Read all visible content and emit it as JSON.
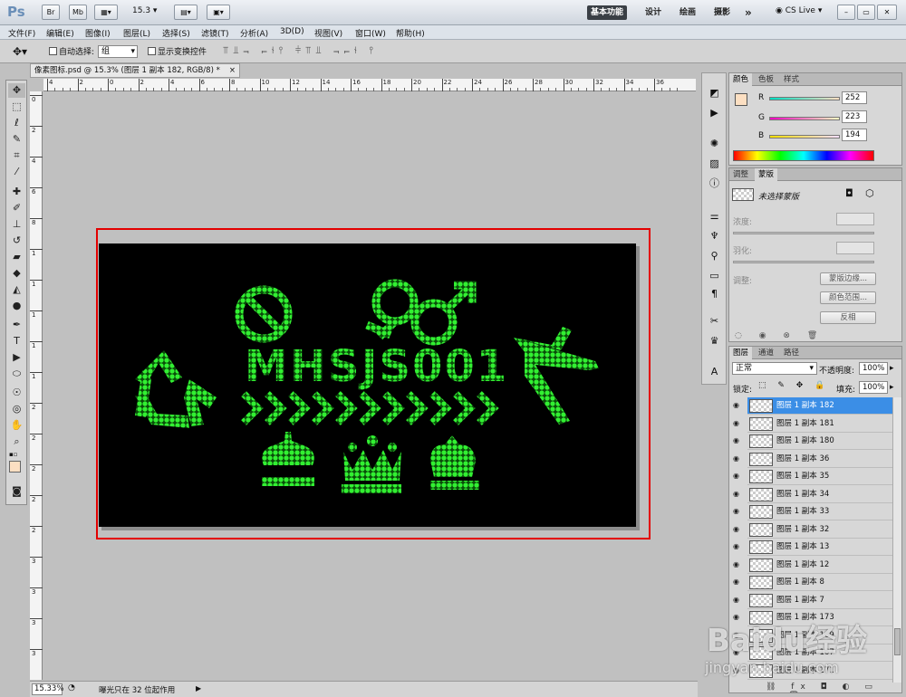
{
  "app": {
    "logo": "Ps",
    "br": "Br",
    "mb": "Mb",
    "zoom": "15.3",
    "workspaces": [
      "基本功能",
      "设计",
      "绘画",
      "摄影"
    ],
    "more": "»",
    "cslive": "CS Live"
  },
  "menu": [
    "文件(F)",
    "编辑(E)",
    "图像(I)",
    "图层(L)",
    "选择(S)",
    "滤镜(T)",
    "分析(A)",
    "3D(D)",
    "视图(V)",
    "窗口(W)",
    "帮助(H)"
  ],
  "options": {
    "auto_select": "自动选择:",
    "group": "组",
    "show_transform": "显示变换控件"
  },
  "document": {
    "tab_title": "像素图标.psd @ 15.3% (图层 1 副本 182, RGB/8) *",
    "close": "×",
    "text": "MHSJS001",
    "ruler_top": [
      "4",
      "2",
      "0",
      "2",
      "4",
      "6",
      "8",
      "10",
      "12",
      "14",
      "16",
      "18",
      "20",
      "22",
      "24",
      "26",
      "28",
      "30",
      "32",
      "34",
      "36"
    ],
    "ruler_left": [
      "0",
      "2",
      "4",
      "6",
      "8",
      "1",
      "1",
      "1",
      "1",
      "1",
      "2",
      "2",
      "2",
      "2",
      "2",
      "3",
      "3",
      "3",
      "3"
    ]
  },
  "status": {
    "zoom": "15.33%",
    "info": "曝光只在 32 位起作用"
  },
  "color_panel": {
    "tabs": [
      "颜色",
      "色板",
      "样式"
    ],
    "r_label": "R",
    "g_label": "G",
    "b_label": "B",
    "r": "252",
    "g": "223",
    "b": "194",
    "swatch": "#fcdfc2"
  },
  "adjust_panel": {
    "tabs": [
      "调整",
      "蒙版"
    ],
    "mask_label": "未选择蒙版",
    "density": "浓度:",
    "feather": "羽化:",
    "refine": "调整:",
    "mask_edge": "蒙版边缘...",
    "color_range": "颜色范围...",
    "invert": "反相"
  },
  "layers_panel": {
    "tabs": [
      "图层",
      "通道",
      "路径"
    ],
    "blend": "正常",
    "opacity_label": "不透明度:",
    "opacity": "100%",
    "lock_label": "锁定:",
    "fill_label": "填充:",
    "fill": "100%",
    "layers": [
      "图层 1 副本 182",
      "图层 1 副本 181",
      "图层 1 副本 180",
      "图层 1 副本 36",
      "图层 1 副本 35",
      "图层 1 副本 34",
      "图层 1 副本 33",
      "图层 1 副本 32",
      "图层 1 副本 13",
      "图层 1 副本 12",
      "图层 1 副本 8",
      "图层 1 副本 7",
      "图层 1 副本 173",
      "图层 1 副本 169",
      "图层 1 副本 167",
      "图层 1 副本 171"
    ]
  },
  "watermark": {
    "text": "Baidu经验",
    "url": "jingyan.baidu.com"
  },
  "colors": {
    "accent_green": "#22ee22",
    "highlight_red": "#e30000",
    "selected_layer": "#3b8ee6"
  }
}
